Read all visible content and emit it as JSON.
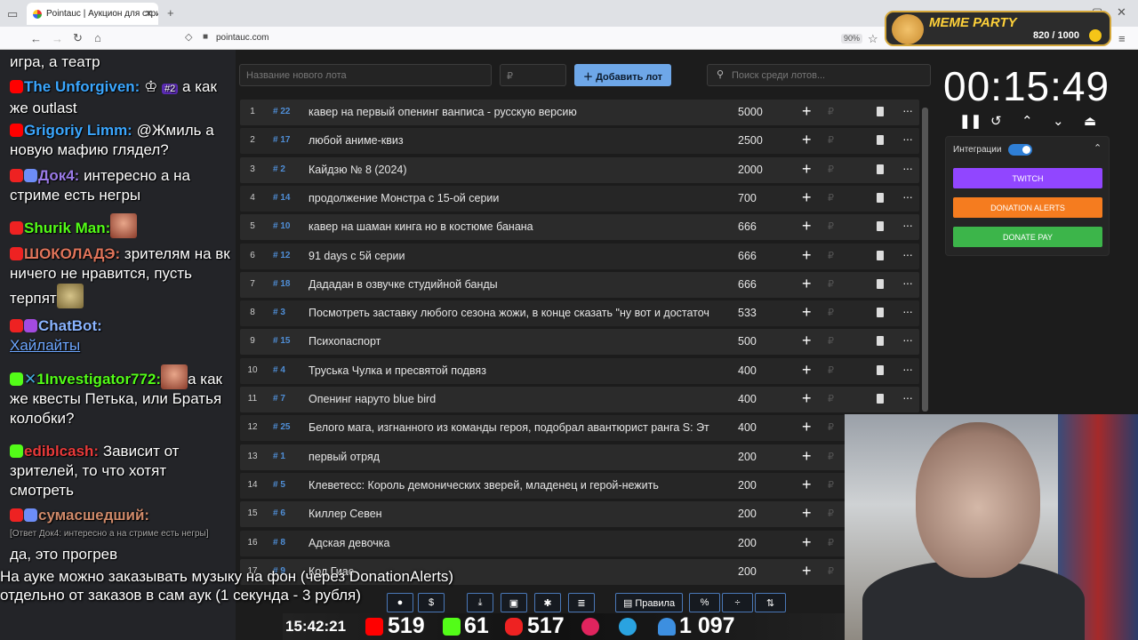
{
  "browser": {
    "tab_title": "Pointauc | Аукцион для стрим",
    "url": "pointauc.com",
    "zoom": "90%"
  },
  "meme": {
    "title": "MEME PARTY",
    "score": "820 / 1000"
  },
  "chat": [
    {
      "author": "",
      "text": "игра, а театр"
    },
    {
      "author": "The Unforgiven:",
      "author_color": "#3ba7ff",
      "badge": "#2",
      "text": "а как же outlast"
    },
    {
      "author": "Grigoriy Limm:",
      "author_color": "#3ba7ff",
      "text": "@Жмиль а новую мафию глядел?"
    },
    {
      "author": "Док4:",
      "author_color": "#9b7be8",
      "text": "интересно а на стриме есть негры"
    },
    {
      "author": "Shurik Man:",
      "author_color": "#53fc18",
      "text": ""
    },
    {
      "author": "ШОКОЛАДЭ:",
      "author_color": "#e0745a",
      "text": "зрителям на вк ничего не нравится, пусть терпят"
    },
    {
      "author": "ChatBot:",
      "author_color": "#8ab4ff",
      "text": "",
      "link": "Хайлайты"
    },
    {
      "author": "1Investigator772:",
      "author_color": "#53fc18",
      "text": "а как же квесты Петька, или Братья колобки?"
    },
    {
      "author": "ediblcash:",
      "author_color": "#e83a3a",
      "text": "Зависит от зрителей, то что хотят смотреть"
    },
    {
      "author": "сумасшедший:",
      "author_color": "#d08a6a",
      "text": "",
      "reply": "[Ответ Док4: интересно а на стриме есть негры]"
    },
    {
      "author": "",
      "text": "да, это прогрев"
    }
  ],
  "auction": {
    "new_lot_placeholder": "Название нового лота",
    "amount_placeholder": "₽",
    "add_button": "Добавить лот",
    "search_placeholder": "Поиск среди лотов...",
    "plus_icon_text": "+",
    "ruble": "₽",
    "more_text": "···",
    "lots": [
      {
        "n": "1",
        "id": "# 22",
        "title": "кавер на первый опенинг ванписа - русскую версию",
        "amount": "5000"
      },
      {
        "n": "2",
        "id": "# 17",
        "title": "любой аниме-квиз",
        "amount": "2500"
      },
      {
        "n": "3",
        "id": "# 2",
        "title": "Кайдзю № 8 (2024)",
        "amount": "2000"
      },
      {
        "n": "4",
        "id": "# 14",
        "title": "продолжение Монстра с 15-ой серии",
        "amount": "700"
      },
      {
        "n": "5",
        "id": "# 10",
        "title": "кавер на шаман кинга но в костюме банана",
        "amount": "666"
      },
      {
        "n": "6",
        "id": "# 12",
        "title": "91 days с 5й серии",
        "amount": "666"
      },
      {
        "n": "7",
        "id": "# 18",
        "title": "Дададан в озвучке студийной банды",
        "amount": "666"
      },
      {
        "n": "8",
        "id": "# 3",
        "title": "Посмотреть заставку любого сезона жожи, в конце сказать \"ну вот и достаточ",
        "amount": "533"
      },
      {
        "n": "9",
        "id": "# 15",
        "title": "Психопаспорт",
        "amount": "500"
      },
      {
        "n": "10",
        "id": "# 4",
        "title": "Труська Чулка и пресвятой подвяз",
        "amount": "400"
      },
      {
        "n": "11",
        "id": "# 7",
        "title": "Опенинг наруто blue bird",
        "amount": "400"
      },
      {
        "n": "12",
        "id": "# 25",
        "title": "Белого мага, изгнанного из команды героя, подобрал авантюрист ранга S: Эт",
        "amount": "400"
      },
      {
        "n": "13",
        "id": "# 1",
        "title": "первый отряд",
        "amount": "200"
      },
      {
        "n": "14",
        "id": "# 5",
        "title": "Клеветесс: Король демонических зверей, младенец и герой-нежить",
        "amount": "200"
      },
      {
        "n": "15",
        "id": "# 6",
        "title": "Киллер Севен",
        "amount": "200"
      },
      {
        "n": "16",
        "id": "# 8",
        "title": "Адская девочка",
        "amount": "200"
      },
      {
        "n": "17",
        "id": "# 9",
        "title": "Код Гиас",
        "amount": "200"
      }
    ]
  },
  "timer": {
    "time": "00:15:49",
    "integrations_label": "Интеграции",
    "twitch": "TWITCH",
    "donation_alerts": "DONATION ALERTS",
    "donate_pay": "DONATE PAY"
  },
  "bottom": {
    "rules": "Правила",
    "percent": "%",
    "dollar": "$"
  },
  "overlay": {
    "line1": "На ауке можно заказывать музыку на фон (через DonationAlerts)",
    "line2": "отдельно от заказов в сам аук (1 секунда - 3 рубля)"
  },
  "stats": {
    "clock": "15:42:21",
    "youtube": "519",
    "kick": "61",
    "live": "517",
    "viewers": "1 097"
  },
  "colors": {
    "accent": "#6ea7e8",
    "twitch": "#9146ff",
    "donation_alerts": "#f57c1f",
    "donate_pay": "#3cb54a"
  }
}
